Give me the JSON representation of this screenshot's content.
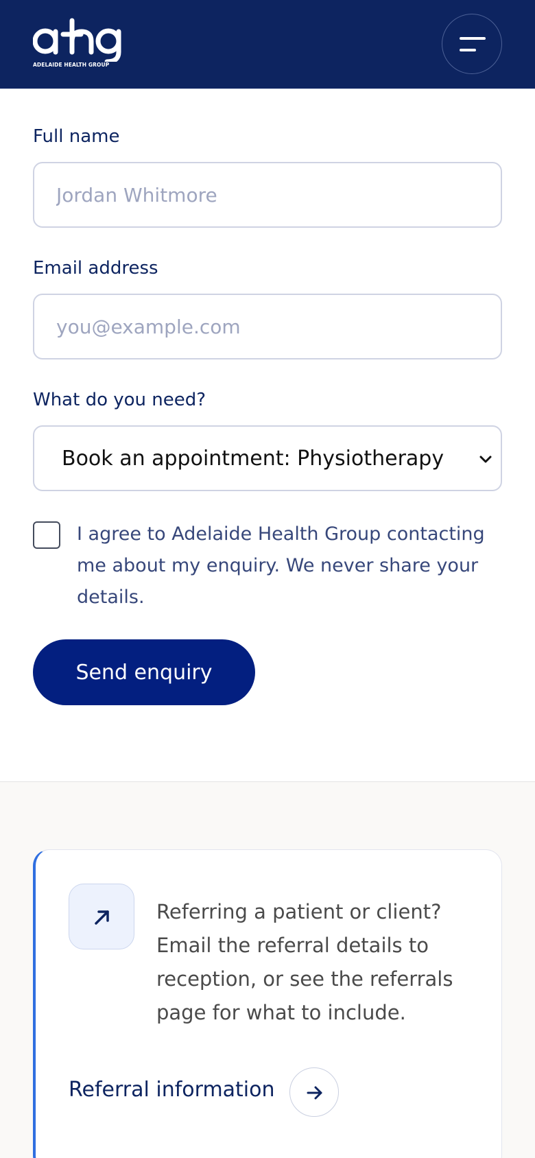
{
  "header": {
    "logo_text": "ahg",
    "logo_subtitle": "ADELAIDE HEALTH GROUP",
    "menu_icon": "hamburger-menu-icon"
  },
  "form": {
    "full_name": {
      "label": "Full name",
      "placeholder": "Jordan Whitmore",
      "value": ""
    },
    "email": {
      "label": "Email address",
      "placeholder": "you@example.com",
      "value": ""
    },
    "need": {
      "label": "What do you need?",
      "selected": "Book an appointment: Physiotherapy"
    },
    "consent_text": "I agree to Adelaide Health Group contacting me about my enquiry. We never share your details.",
    "submit_label": "Send enquiry"
  },
  "referral_card": {
    "icon": "arrow-up-right-icon",
    "text": "Referring a patient or client? Email the referral details to reception, or see the referrals page for what to include.",
    "link_label": "Referral information",
    "link_icon": "arrow-right-icon"
  },
  "colors": {
    "header_bg": "#0d2460",
    "primary_button": "#031f80",
    "accent_border": "#2f6fe0",
    "label_text": "#0d2460"
  }
}
